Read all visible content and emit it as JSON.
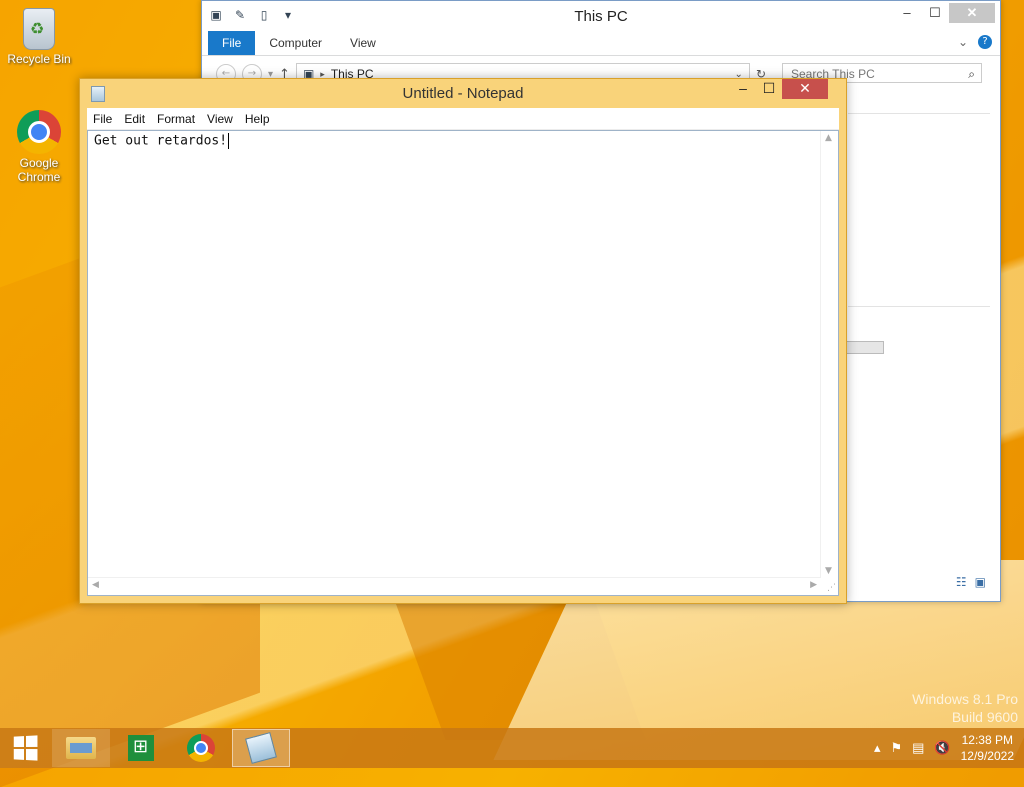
{
  "desktop": {
    "icons": [
      {
        "label": "Recycle Bin",
        "icon": "recycle-bin-icon"
      },
      {
        "label": "Google Chrome",
        "icon": "chrome-icon"
      }
    ],
    "watermark": {
      "line1": "Windows 8.1 Pro",
      "line2": "Build 9600"
    }
  },
  "explorer": {
    "title": "This PC",
    "tabs": [
      "File",
      "Computer",
      "View"
    ],
    "address": "This PC",
    "search_placeholder": "Search This PC"
  },
  "notepad": {
    "title": "Untitled - Notepad",
    "menu": [
      "File",
      "Edit",
      "Format",
      "View",
      "Help"
    ],
    "content": "Get out retardos!"
  },
  "taskbar": {
    "items": [
      "file-explorer",
      "store",
      "chrome",
      "notepad"
    ],
    "active": "notepad",
    "clock": {
      "time": "12:38 PM",
      "date": "12/9/2022"
    }
  },
  "colors": {
    "accent": "#1979ca",
    "close_red": "#c7504c",
    "notepad_frame": "#f9d37a"
  }
}
